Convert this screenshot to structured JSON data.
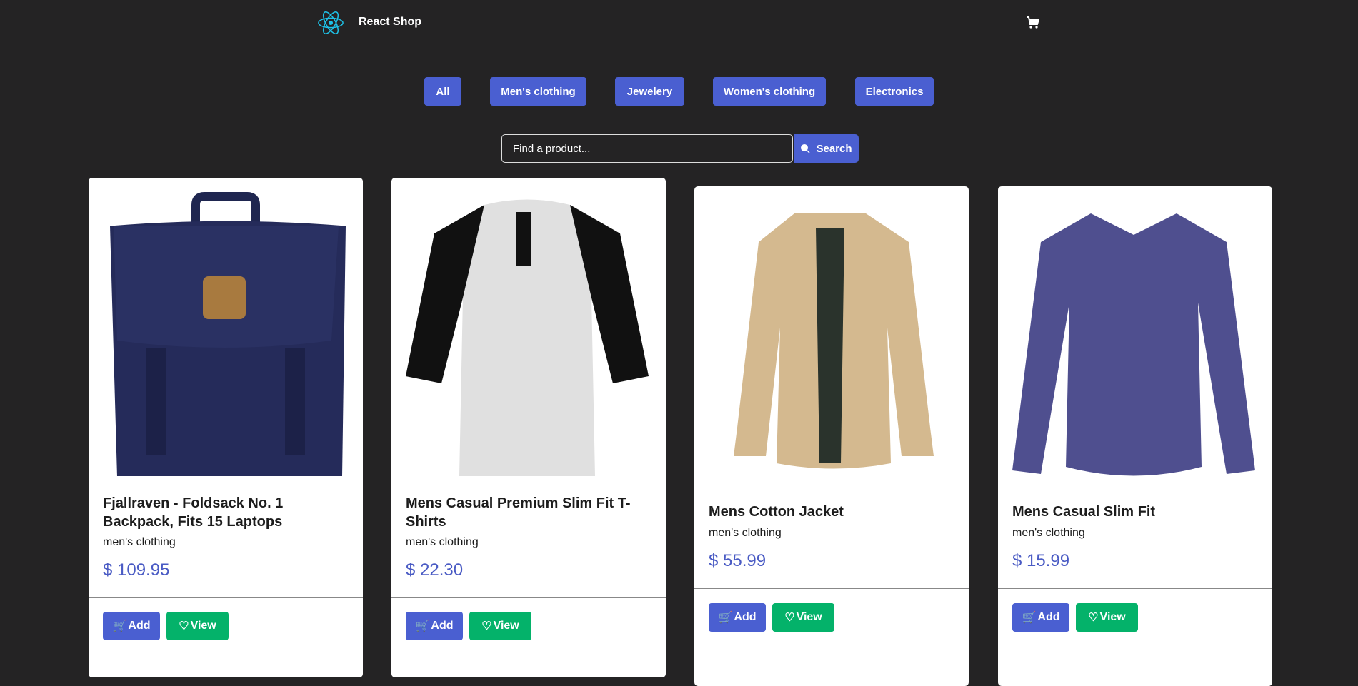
{
  "header": {
    "brand": "React Shop",
    "logo": "react-atom-icon",
    "cart_icon": "cart-icon"
  },
  "categories": [
    {
      "label": "All"
    },
    {
      "label": "Men's clothing"
    },
    {
      "label": "Jewelery"
    },
    {
      "label": "Women's clothing"
    },
    {
      "label": "Electronics"
    }
  ],
  "search": {
    "placeholder": "Find a product...",
    "value": "",
    "button": "Search"
  },
  "colors": {
    "accent": "#4a5fd1",
    "view": "#04b26a",
    "price": "#4a5bc4",
    "background": "#242324"
  },
  "products": [
    {
      "title": "Fjallraven - Foldsack No. 1 Backpack, Fits 15 Laptops",
      "category": "men's clothing",
      "price": "$ 109.95",
      "add": "Add",
      "view": "View"
    },
    {
      "title": "Mens Casual Premium Slim Fit T-Shirts",
      "category": "men's clothing",
      "price": "$ 22.30",
      "add": "Add",
      "view": "View"
    },
    {
      "title": "Mens Cotton Jacket",
      "category": "men's clothing",
      "price": "$ 55.99",
      "add": "Add",
      "view": "View"
    },
    {
      "title": "Mens Casual Slim Fit",
      "category": "men's clothing",
      "price": "$ 15.99",
      "add": "Add",
      "view": "View"
    }
  ]
}
